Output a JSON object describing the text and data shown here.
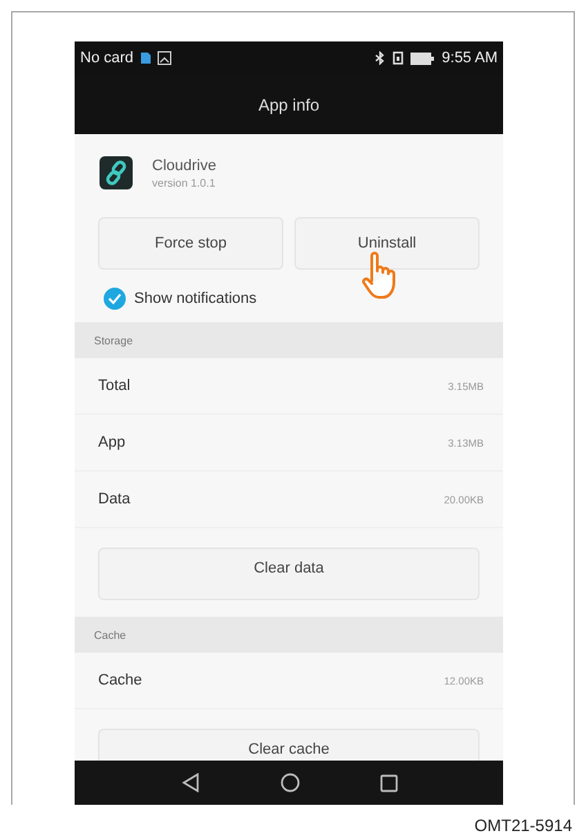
{
  "status_bar": {
    "carrier": "No card",
    "time": "9:55 AM"
  },
  "title_bar": {
    "title": "App info"
  },
  "app": {
    "name": "Cloudrive",
    "version": "version 1.0.1"
  },
  "action_buttons": [
    {
      "label": "Force stop",
      "pointed": false
    },
    {
      "label": "Uninstall",
      "pointed": true
    }
  ],
  "notifications": {
    "label": "Show notifications",
    "checked": true
  },
  "sections": [
    {
      "header": "Storage",
      "rows": [
        {
          "label": "Total",
          "value": "3.15MB"
        },
        {
          "label": "App",
          "value": "3.13MB"
        },
        {
          "label": "Data",
          "value": "20.00KB"
        }
      ],
      "button": "Clear data"
    },
    {
      "header": "Cache",
      "rows": [
        {
          "label": "Cache",
          "value": "12.00KB"
        }
      ],
      "button": "Clear cache"
    }
  ],
  "caption": "OMT21-5914"
}
